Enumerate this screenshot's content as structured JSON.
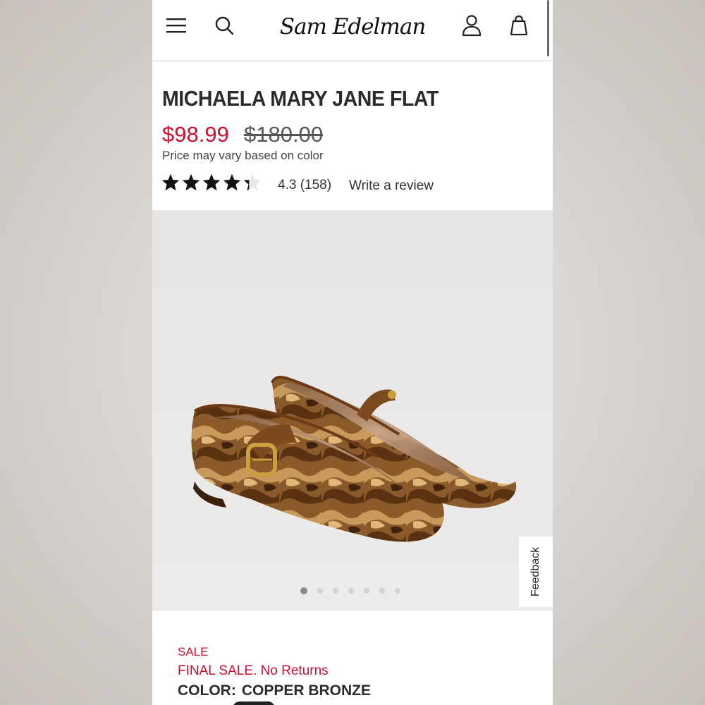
{
  "header": {
    "logo_text": "Sam Edelman",
    "menu_icon": "hamburger-menu-icon",
    "search_icon": "search-icon",
    "account_icon": "user-icon",
    "bag_icon": "shopping-bag-icon"
  },
  "product": {
    "title": "MICHAELA MARY JANE FLAT",
    "sale_price": "$98.99",
    "original_price": "$180.00",
    "price_note": "Price may vary based on color",
    "rating_value": 4.3,
    "rating_text": "4.3 (158)",
    "write_review": "Write a review"
  },
  "gallery": {
    "image_icon": "mary-jane-flats-image",
    "dot_count": 7,
    "active_dot": 1
  },
  "feedback_tab": "Feedback",
  "details": {
    "sale_label": "SALE",
    "final_sale": "FINAL SALE. No Returns",
    "color_label": "COLOR:",
    "color_value": "COPPER BRONZE"
  },
  "colors": {
    "sale_red": "#c8102e",
    "text_dark": "#2b2b2b"
  }
}
